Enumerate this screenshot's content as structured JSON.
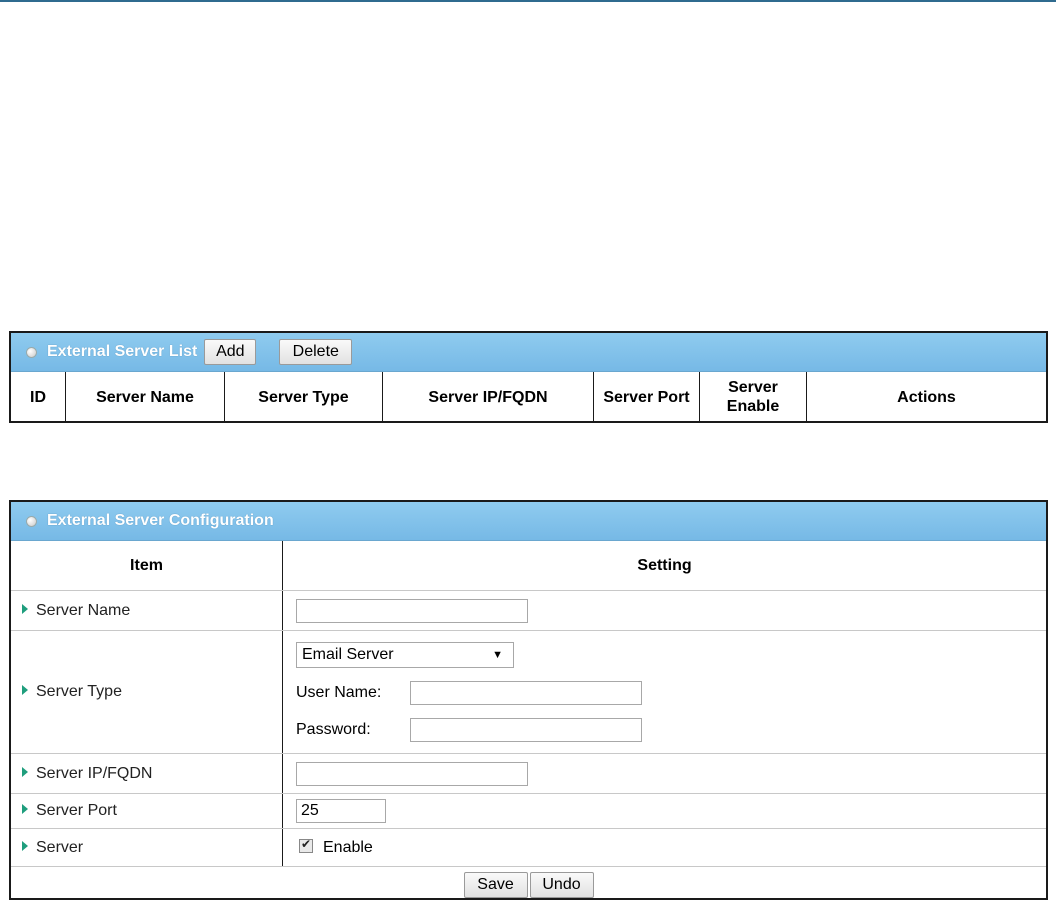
{
  "list": {
    "title": "External Server List",
    "add_label": "Add",
    "delete_label": "Delete",
    "columns": [
      "ID",
      "Server Name",
      "Server Type",
      "Server IP/FQDN",
      "Server Port",
      "Server Enable",
      "Actions"
    ]
  },
  "config": {
    "title": "External Server Configuration",
    "head_item": "Item",
    "head_setting": "Setting",
    "rows": {
      "server_name": "Server Name",
      "server_type": "Server Type",
      "server_ip": "Server IP/FQDN",
      "server_port": "Server Port",
      "server": "Server"
    },
    "server_type_value": "Email Server",
    "user_name_label": "User Name:",
    "password_label": "Password:",
    "server_port_value": "25",
    "enable_label": "Enable",
    "save_label": "Save",
    "undo_label": "Undo"
  },
  "colors": {
    "header_blue": "#7fc1ea",
    "arrow_green": "#1f9e7d"
  }
}
